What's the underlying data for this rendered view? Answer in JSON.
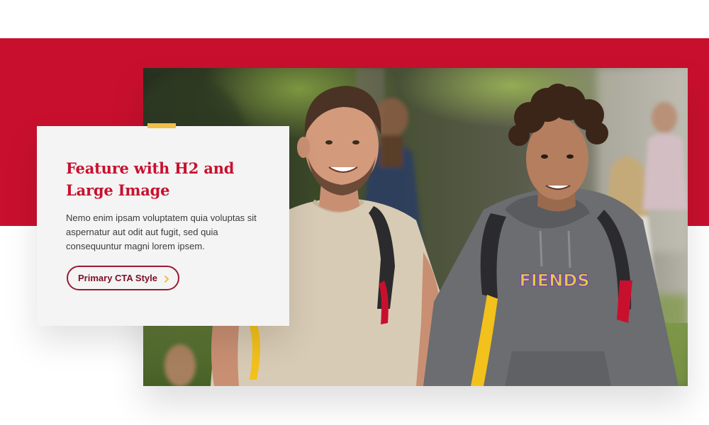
{
  "feature": {
    "heading": "Feature with H2 and Large Image",
    "body": "Nemo enim ipsam voluptatem quia voluptas sit aspernatur aut odit aut fugit, sed quia consequuntur magni lorem ipsem.",
    "cta_label": "Primary CTA Style",
    "cta_icon": "chevron-right-icon"
  },
  "photo": {
    "shirt_text": "FIENDS"
  },
  "colors": {
    "brand_red": "#c8102e",
    "accent_gold": "#f1be48",
    "cta_border": "#9a1a33",
    "card_background": "#f4f4f4"
  }
}
